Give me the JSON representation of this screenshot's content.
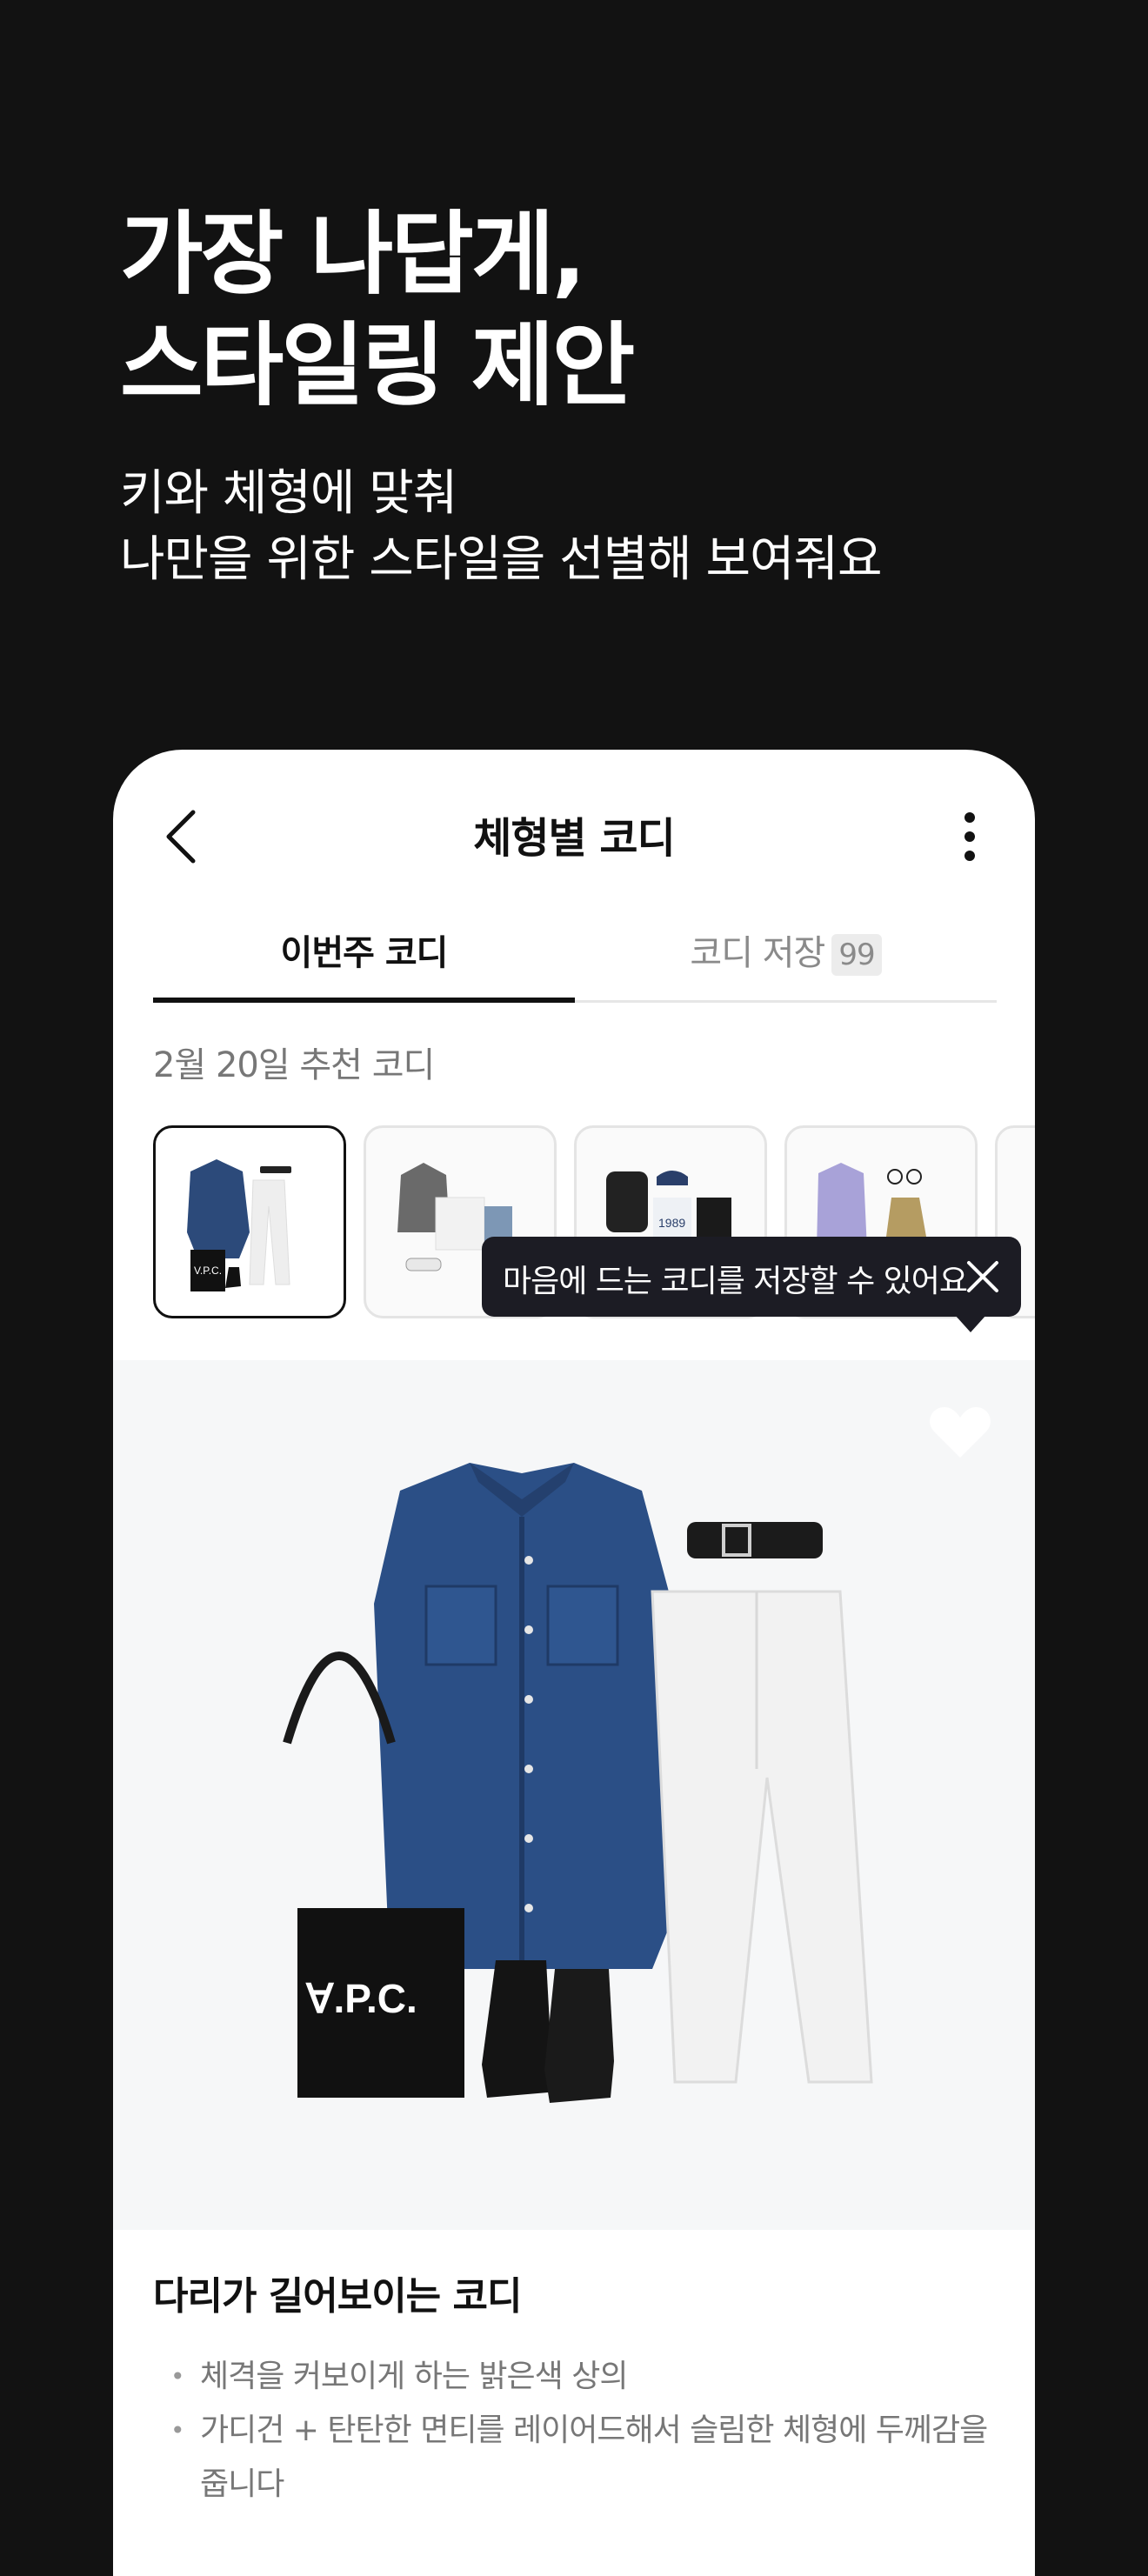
{
  "hero": {
    "title_line1": "가장 나답게,",
    "title_line2": "스타일링 제안",
    "sub_line1": "키와 체형에 맞춰",
    "sub_line2": "나만을 위한 스타일을 선별해 보여줘요"
  },
  "nav": {
    "title": "체형별 코디",
    "back_icon": "chevron-left-icon",
    "more_icon": "more-vertical-icon"
  },
  "tabs": {
    "active_label": "이번주 코디",
    "saved_label": "코디 저장",
    "saved_count": "99"
  },
  "date_label": "2월 20일 추천 코디",
  "tooltip": {
    "text": "마음에 드는 코디를 저장할 수 있어요",
    "close_icon": "close-icon"
  },
  "thumbnails": [
    {
      "selected": true
    },
    {
      "selected": false
    },
    {
      "selected": false
    },
    {
      "selected": false
    },
    {
      "selected": false
    }
  ],
  "outfit": {
    "bag_text": "∀.P.C.",
    "heart_icon": "heart-icon"
  },
  "card": {
    "title": "다리가 길어보이는 코디",
    "bullets": [
      "체격을 커보이게 하는 밝은색 상의",
      "가디건 + 탄탄한 면티를 레이어드해서 슬림한 체형에 두께감을 줍니다"
    ]
  }
}
